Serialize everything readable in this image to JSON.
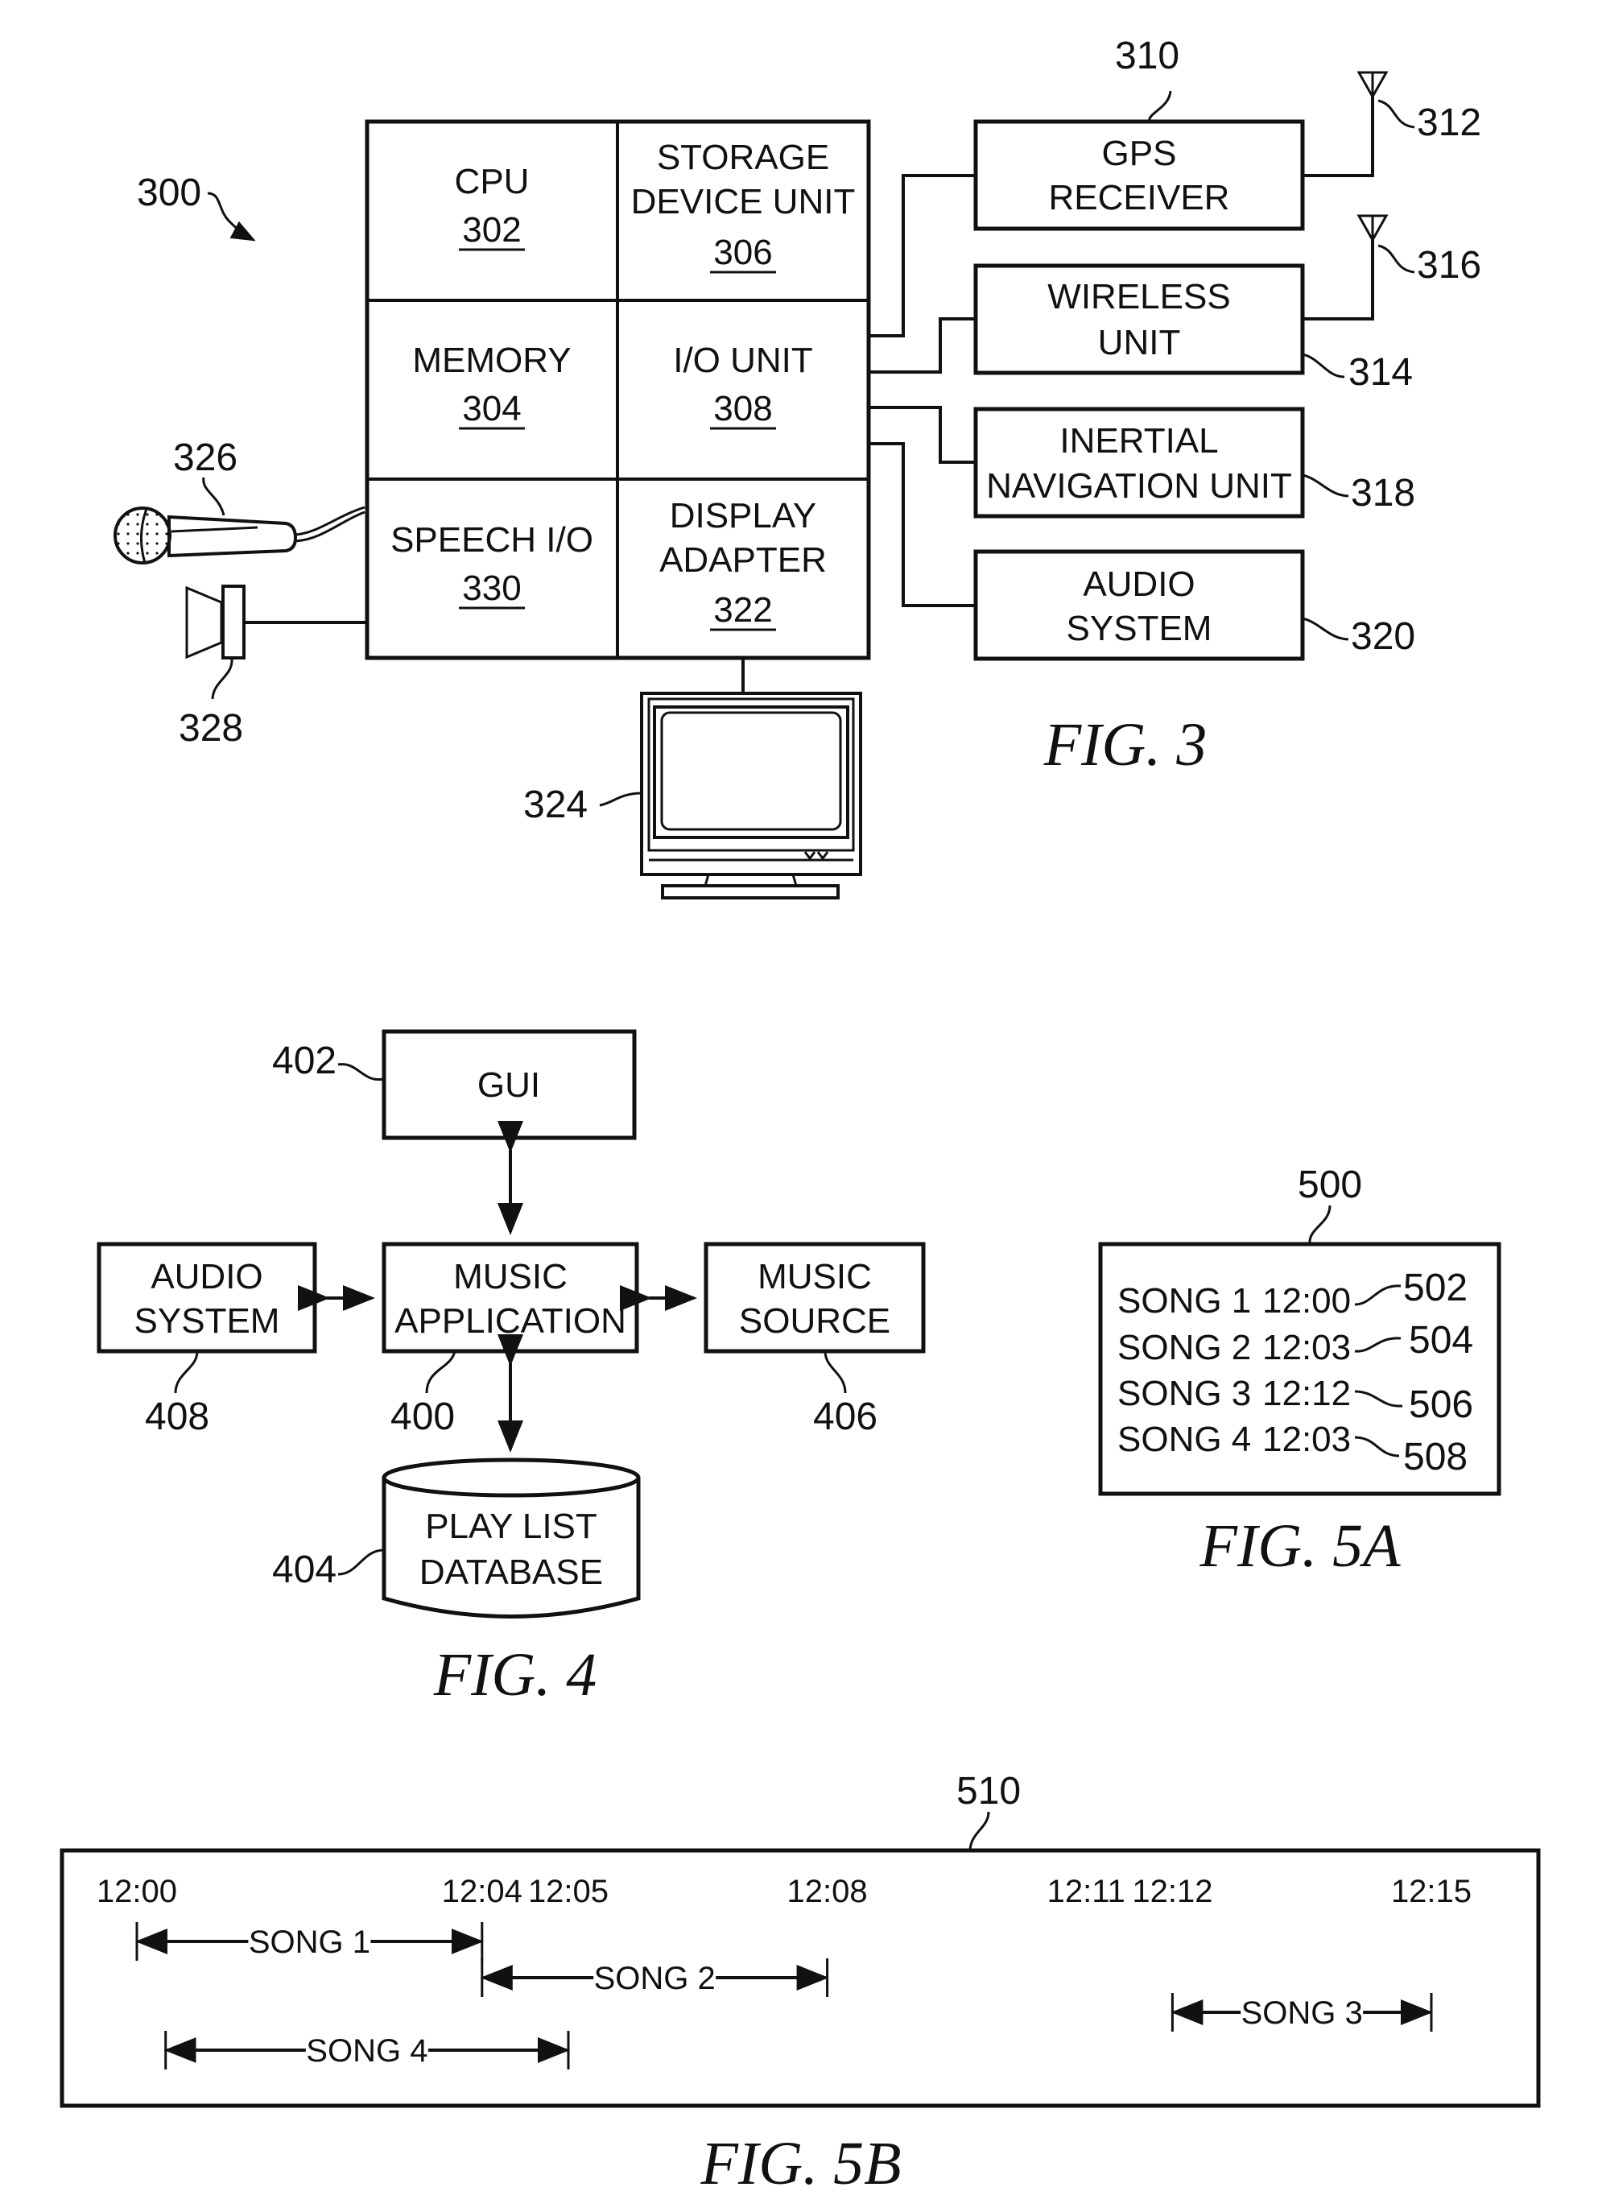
{
  "fig3": {
    "caption": "FIG. 3",
    "system_ref": "300",
    "cells": [
      {
        "title": [
          "CPU"
        ],
        "ref": "302"
      },
      {
        "title": [
          "STORAGE",
          "DEVICE UNIT"
        ],
        "ref": "306"
      },
      {
        "title": [
          "MEMORY"
        ],
        "ref": "304"
      },
      {
        "title": [
          "I/O UNIT"
        ],
        "ref": "308"
      },
      {
        "title": [
          "SPEECH I/O"
        ],
        "ref": "330"
      },
      {
        "title": [
          "DISPLAY",
          "ADAPTER"
        ],
        "ref": "322"
      }
    ],
    "peripherals": [
      {
        "title": [
          "GPS",
          "RECEIVER"
        ],
        "ref": "310",
        "antenna_ref": "312"
      },
      {
        "title": [
          "WIRELESS",
          "UNIT"
        ],
        "ref": "314",
        "antenna_ref": "316"
      },
      {
        "title": [
          "INERTIAL",
          "NAVIGATION UNIT"
        ],
        "ref": "318"
      },
      {
        "title": [
          "AUDIO",
          "SYSTEM"
        ],
        "ref": "320"
      }
    ],
    "microphone_ref": "326",
    "speaker_ref": "328",
    "monitor_ref": "324"
  },
  "fig4": {
    "caption": "FIG. 4",
    "gui": {
      "title": [
        "GUI"
      ],
      "ref": "402"
    },
    "music_app": {
      "title": [
        "MUSIC",
        "APPLICATION"
      ],
      "ref": "400"
    },
    "audio_system": {
      "title": [
        "AUDIO",
        "SYSTEM"
      ],
      "ref": "408"
    },
    "music_source": {
      "title": [
        "MUSIC",
        "SOURCE"
      ],
      "ref": "406"
    },
    "playlist_db": {
      "title": [
        "PLAY LIST",
        "DATABASE"
      ],
      "ref": "404"
    }
  },
  "fig5a": {
    "caption": "FIG. 5A",
    "ref": "500",
    "rows": [
      {
        "song": "SONG 1",
        "time": "12:00",
        "ref": "502"
      },
      {
        "song": "SONG 2",
        "time": "12:03",
        "ref": "504"
      },
      {
        "song": "SONG 3",
        "time": "12:12",
        "ref": "506"
      },
      {
        "song": "SONG 4",
        "time": "12:03",
        "ref": "508"
      }
    ]
  },
  "fig5b": {
    "caption": "FIG. 5B",
    "ref": "510",
    "ticks": [
      "12:00",
      "12:04",
      "12:05",
      "12:08",
      "12:11",
      "12:12",
      "12:15"
    ],
    "spans": [
      {
        "label": "SONG 1",
        "start": "12:00",
        "end": "12:04"
      },
      {
        "label": "SONG 2",
        "start": "12:04",
        "end": "12:08"
      },
      {
        "label": "SONG 3",
        "start": "12:12",
        "end": "12:15"
      },
      {
        "label": "SONG 4",
        "start": "12:00:20",
        "end": "12:05"
      }
    ]
  }
}
